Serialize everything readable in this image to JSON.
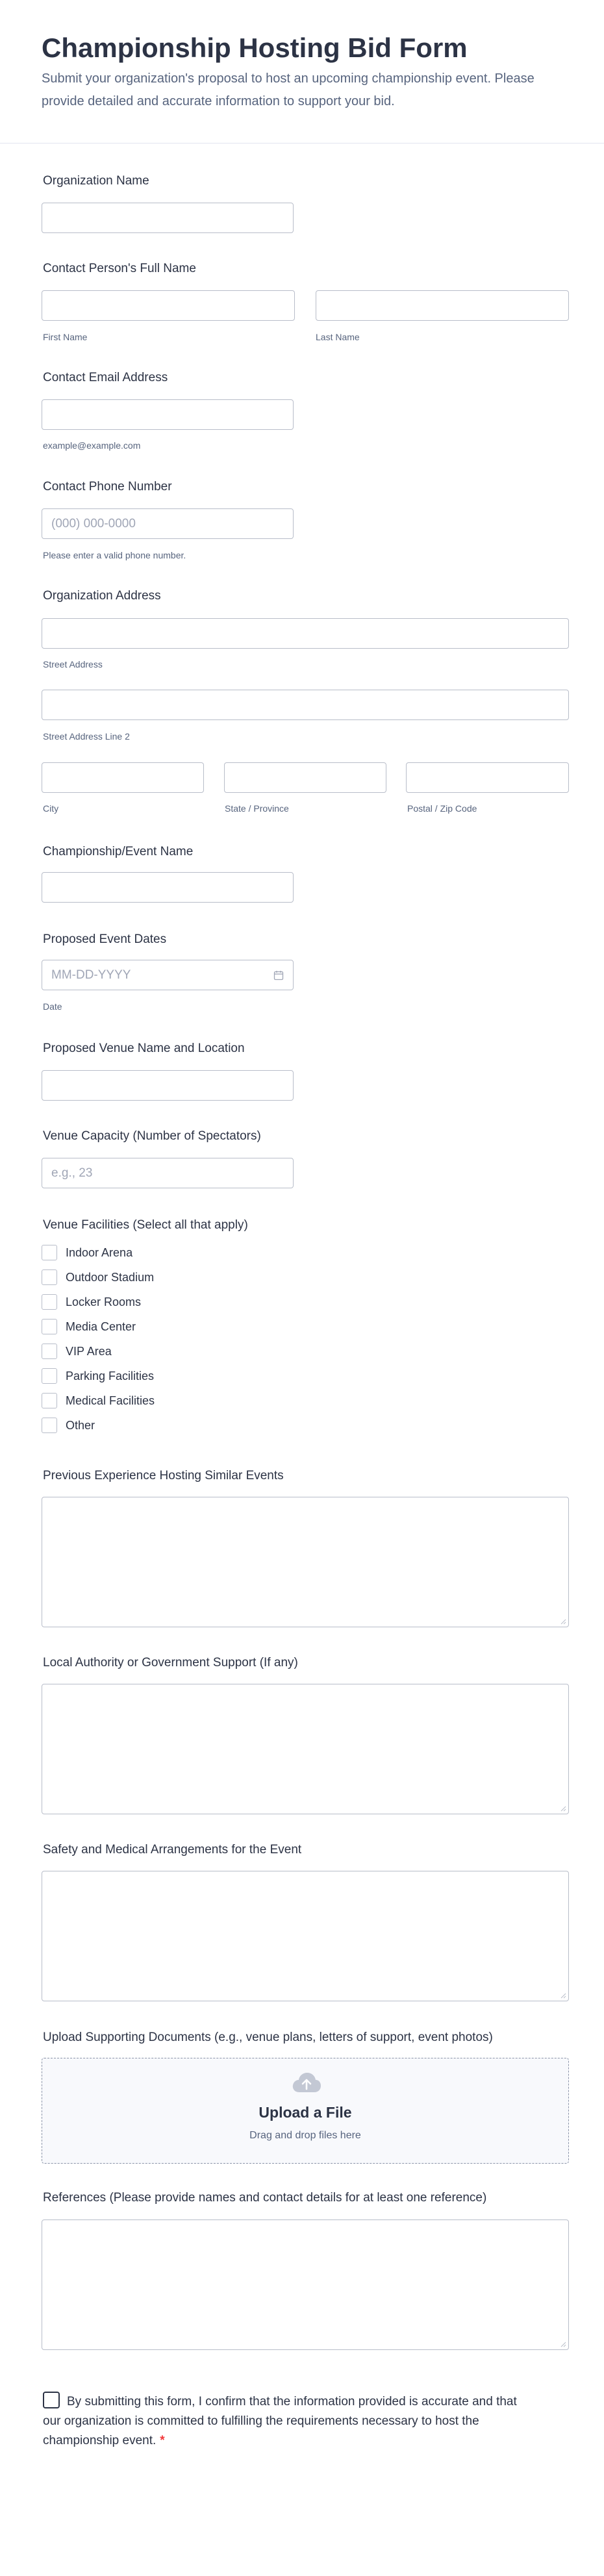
{
  "header": {
    "title": "Championship Hosting Bid Form",
    "subtitle": "Submit your organization's proposal to host an upcoming championship event. Please provide detailed and accurate information to support your bid."
  },
  "fields": {
    "org_name": {
      "label": "Organization Name"
    },
    "contact_name": {
      "label": "Contact Person's Full Name",
      "first_sublabel": "First Name",
      "last_sublabel": "Last Name"
    },
    "email": {
      "label": "Contact Email Address",
      "sublabel": "example@example.com"
    },
    "phone": {
      "label": "Contact Phone Number",
      "placeholder": "(000) 000-0000",
      "sublabel": "Please enter a valid phone number."
    },
    "address": {
      "label": "Organization Address",
      "street_sublabel": "Street Address",
      "street2_sublabel": "Street Address Line 2",
      "city_sublabel": "City",
      "state_sublabel": "State / Province",
      "zip_sublabel": "Postal / Zip Code"
    },
    "event_name": {
      "label": "Championship/Event Name"
    },
    "dates": {
      "label": "Proposed Event Dates",
      "placeholder": "MM-DD-YYYY",
      "sublabel": "Date",
      "icon": "calendar-icon"
    },
    "venue": {
      "label": "Proposed Venue Name and Location"
    },
    "capacity": {
      "label": "Venue Capacity (Number of Spectators)",
      "placeholder": "e.g., 23"
    },
    "facilities": {
      "label": "Venue Facilities (Select all that apply)",
      "options": [
        "Indoor Arena",
        "Outdoor Stadium",
        "Locker Rooms",
        "Media Center",
        "VIP Area",
        "Parking Facilities",
        "Medical Facilities",
        "Other"
      ]
    },
    "experience": {
      "label": "Previous Experience Hosting Similar Events"
    },
    "authority": {
      "label": "Local Authority or Government Support (If any)"
    },
    "safety": {
      "label": "Safety and Medical Arrangements for the Event"
    },
    "upload": {
      "label": "Upload Supporting Documents (e.g., venue plans, letters of support, event photos)",
      "title": "Upload a File",
      "hint": "Drag and drop files here",
      "icon": "cloud-upload-icon"
    },
    "references": {
      "label": "References (Please provide names and contact details for at least one reference)"
    },
    "confirm": {
      "text": "By submitting this form, I confirm that the information provided is accurate and that our organization is committed to fulfilling the requirements necessary to host the championship event.",
      "required_mark": "*"
    }
  },
  "colors": {
    "text": "#2c3345",
    "muted": "#57647e",
    "border": "#b8bdc9",
    "required": "#f23a3c"
  }
}
